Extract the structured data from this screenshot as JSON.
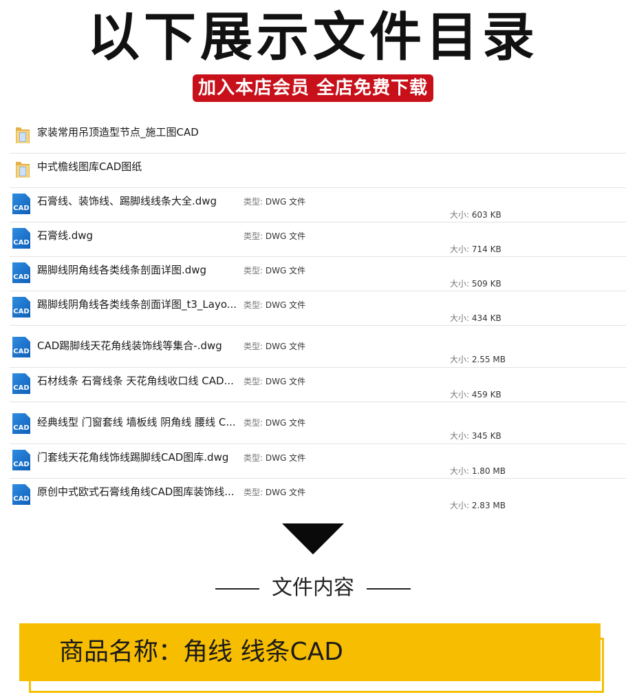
{
  "header": {
    "title": "以下展示文件目录",
    "promo": "加入本店会员 全店免费下载"
  },
  "labels": {
    "type": "类型: ",
    "size": "大小: "
  },
  "files": [
    {
      "kind": "folder",
      "name": "家装常用吊顶造型节点_施工图CAD"
    },
    {
      "kind": "folder",
      "name": "中式檐线图库CAD图纸"
    },
    {
      "kind": "cad",
      "name": "石膏线、装饰线、踢脚线线条大全.dwg",
      "type": "DWG 文件",
      "size": "603 KB"
    },
    {
      "kind": "cad",
      "name": "石膏线.dwg",
      "type": "DWG 文件",
      "size": "714 KB"
    },
    {
      "kind": "cad",
      "name": "踢脚线阴角线各类线条剖面详图.dwg",
      "type": "DWG 文件",
      "size": "509 KB"
    },
    {
      "kind": "cad",
      "name": "踢脚线阴角线各类线条剖面详图_t3_Layo...",
      "type": "DWG 文件",
      "size": "434 KB"
    },
    {
      "kind": "cad",
      "name": "CAD踢脚线天花角线装饰线等集合-.dwg",
      "type": "DWG 文件",
      "size": "2.55 MB"
    },
    {
      "kind": "cad",
      "name": "石材线条 石膏线条 天花角线收口线 CAD...",
      "type": "DWG 文件",
      "size": "459 KB"
    },
    {
      "kind": "cad",
      "name": "经典线型 门窗套线 墙板线 阴角线 腰线 C...",
      "type": "DWG 文件",
      "size": "345 KB"
    },
    {
      "kind": "cad",
      "name": "门套线天花角线饰线踢脚线CAD图库.dwg",
      "type": "DWG 文件",
      "size": "1.80 MB"
    },
    {
      "kind": "cad",
      "name": "原创中式欧式石膏线角线CAD图库装饰线...",
      "type": "DWG 文件",
      "size": "2.83 MB"
    }
  ],
  "cad_icon_text": "CAD",
  "section": {
    "heading": "文件内容"
  },
  "product": {
    "name": "商品名称：角线 线条CAD"
  },
  "colors": {
    "promo_bg": "#c8101a",
    "product_bg": "#f7bd00",
    "cad_icon": "#1a6fc9"
  }
}
